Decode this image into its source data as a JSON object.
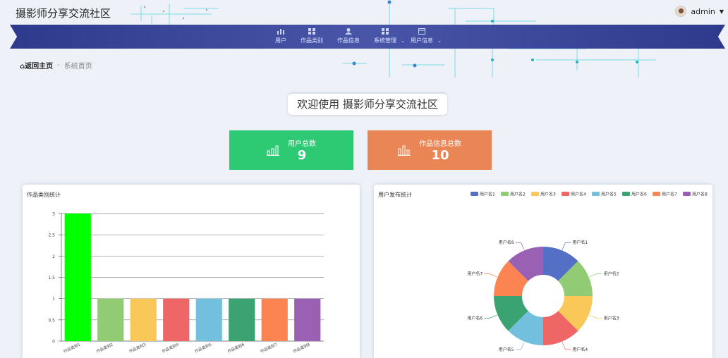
{
  "header": {
    "title": "摄影师分享交流社区",
    "user_name": "admin"
  },
  "nav": {
    "items": [
      {
        "label": "用户",
        "icon": "bar-chart-icon",
        "dropdown": false
      },
      {
        "label": "作品类别",
        "icon": "grid-icon",
        "dropdown": false
      },
      {
        "label": "作品信息",
        "icon": "person-icon",
        "dropdown": false
      },
      {
        "label": "系统管理",
        "icon": "grid-icon",
        "dropdown": true
      },
      {
        "label": "用户信息",
        "icon": "card-icon",
        "dropdown": true
      }
    ]
  },
  "breadcrumb": {
    "home": "返回主页",
    "separator": "-",
    "current": "系统首页"
  },
  "welcome": "欢迎使用 摄影师分享交流社区",
  "stats": [
    {
      "label": "用户总数",
      "value": "9",
      "color": "#2dca73"
    },
    {
      "label": "作品信息总数",
      "value": "10",
      "color": "#ea8555"
    }
  ],
  "panels": {
    "left_title": "作品类别统计",
    "right_title": "用户发布统计"
  },
  "chart_data": [
    {
      "type": "bar",
      "title": "作品类别统计",
      "categories": [
        "作品类别1",
        "作品类别2",
        "作品类别3",
        "作品类别4",
        "作品类别5",
        "作品类别6",
        "作品类别7",
        "作品类别8"
      ],
      "values": [
        3,
        1,
        1,
        1,
        1,
        1,
        1,
        1
      ],
      "colors": [
        "#00ff00",
        "#91cc75",
        "#fac858",
        "#ee6666",
        "#73c0de",
        "#3ba272",
        "#fc8452",
        "#9a60b4"
      ],
      "ylim": [
        0,
        3
      ],
      "yticks": [
        "0",
        "0.5",
        "1",
        "1.5",
        "2",
        "2.5",
        "3"
      ],
      "grid": true
    },
    {
      "type": "pie",
      "title": "用户发布统计",
      "labels": [
        "用户名1",
        "用户名2",
        "用户名3",
        "用户名4",
        "用户名5",
        "用户名6",
        "用户名7",
        "用户名8"
      ],
      "values": [
        1,
        1,
        1,
        1,
        1,
        1,
        1,
        1
      ],
      "colors": [
        "#5470c6",
        "#91cc75",
        "#fac858",
        "#ee6666",
        "#73c0de",
        "#3ba272",
        "#fc8452",
        "#9a60b4"
      ],
      "donut": true,
      "legend_position": "top-right"
    }
  ]
}
